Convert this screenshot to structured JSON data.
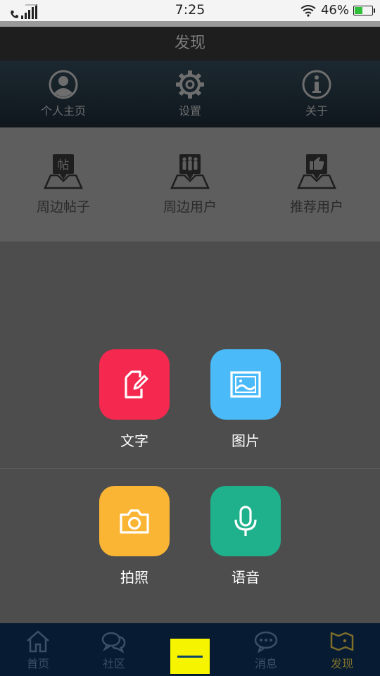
{
  "status": {
    "time": "7:25",
    "battery": "46%",
    "battery_level": 0.46
  },
  "title": "发现",
  "quick_menu": [
    {
      "label": "个人主页",
      "icon": "user-circle-icon"
    },
    {
      "label": "设置",
      "icon": "gear-icon"
    },
    {
      "label": "关于",
      "icon": "info-icon"
    }
  ],
  "features": [
    {
      "label": "周边帖子",
      "icon": "nearby-posts-icon",
      "glyph": "帖"
    },
    {
      "label": "周边用户",
      "icon": "nearby-users-icon"
    },
    {
      "label": "推荐用户",
      "icon": "recommended-users-icon"
    }
  ],
  "post_options": [
    {
      "label": "文字",
      "icon": "edit-text-icon",
      "color": "#f5294f"
    },
    {
      "label": "图片",
      "icon": "image-icon",
      "color": "#4bbaf9"
    },
    {
      "label": "拍照",
      "icon": "camera-icon",
      "color": "#fbb534"
    },
    {
      "label": "语音",
      "icon": "microphone-icon",
      "color": "#1fb18c"
    }
  ],
  "nav": [
    {
      "label": "首页",
      "icon": "home-icon"
    },
    {
      "label": "社区",
      "icon": "chat-bubbles-icon"
    },
    {
      "label": "",
      "icon": "close-bar-icon"
    },
    {
      "label": "消息",
      "icon": "message-icon"
    },
    {
      "label": "发现",
      "icon": "discover-map-icon"
    }
  ],
  "colors": {
    "accent": "#f7f400",
    "nav_bg": "#071c33",
    "active_nav": "#7e6e2a"
  }
}
